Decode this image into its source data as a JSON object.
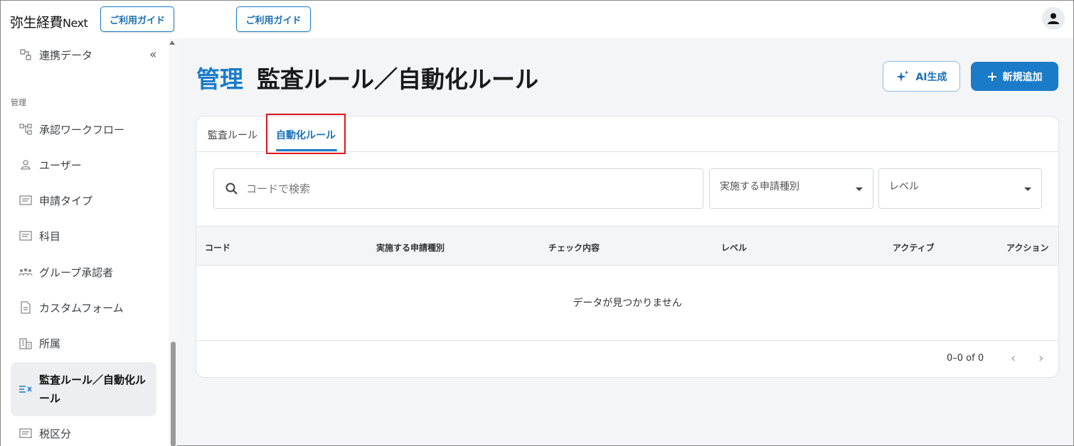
{
  "topbar": {
    "logo": "弥生経費",
    "logo_suffix": "Next",
    "guide_button_1": "ご利用ガイド",
    "guide_button_2": "ご利用ガイド",
    "avatar_icon": "account-icon"
  },
  "sidebar": {
    "top_item": {
      "label": "連携データ",
      "icon": "link-data-icon"
    },
    "section_label": "管理",
    "items": [
      {
        "label": "承認ワークフロー",
        "icon": "workflow-icon"
      },
      {
        "label": "ユーザー",
        "icon": "user-icon"
      },
      {
        "label": "申請タイプ",
        "icon": "form-icon"
      },
      {
        "label": "科目",
        "icon": "form-icon"
      },
      {
        "label": "グループ承認者",
        "icon": "group-icon"
      },
      {
        "label": "カスタムフォーム",
        "icon": "document-icon"
      },
      {
        "label": "所属",
        "icon": "building-icon"
      },
      {
        "label": "監査ルール／自動化ルール",
        "icon": "rule-check-icon",
        "active": true
      },
      {
        "label": "税区分",
        "icon": "form-icon"
      }
    ]
  },
  "main": {
    "title_prefix": "管理",
    "title": "監査ルール／自動化ルール",
    "ai_button": "AI生成",
    "new_button": "新規追加",
    "tabs": [
      {
        "label": "監査ルール",
        "active": false
      },
      {
        "label": "自動化ルール",
        "active": true
      }
    ],
    "search_placeholder": "コードで検索",
    "filter_type": "実施する申請種別",
    "filter_level": "レベル",
    "columns": [
      "コード",
      "実施する申請種別",
      "チェック内容",
      "レベル",
      "アクティブ",
      "アクション"
    ],
    "empty_message": "データが見つかりません",
    "pagination": "0–0 of 0"
  },
  "colors": {
    "accent": "#1a7bc9",
    "highlight": "#e0151c"
  }
}
